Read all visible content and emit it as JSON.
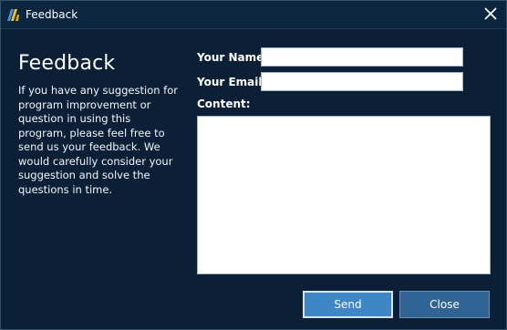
{
  "window": {
    "title": "Feedback",
    "app_icon": "app-logo-icon",
    "close_icon": "close-icon"
  },
  "intro": {
    "heading": "Feedback",
    "description": "If you have any suggestion for program improvement or question in using this program, please feel free to send us your feedback. We would carefully consider your suggestion and solve the questions in time."
  },
  "form": {
    "name_label": "Your Name:",
    "name_value": "",
    "email_label": "Your Email:",
    "email_value": "",
    "content_label": "Content:",
    "content_value": ""
  },
  "buttons": {
    "send_label": "Send",
    "close_label": "Close"
  },
  "colors": {
    "background": "#0b2036",
    "send_button": "#3f86c6",
    "close_button": "#2f6494"
  }
}
